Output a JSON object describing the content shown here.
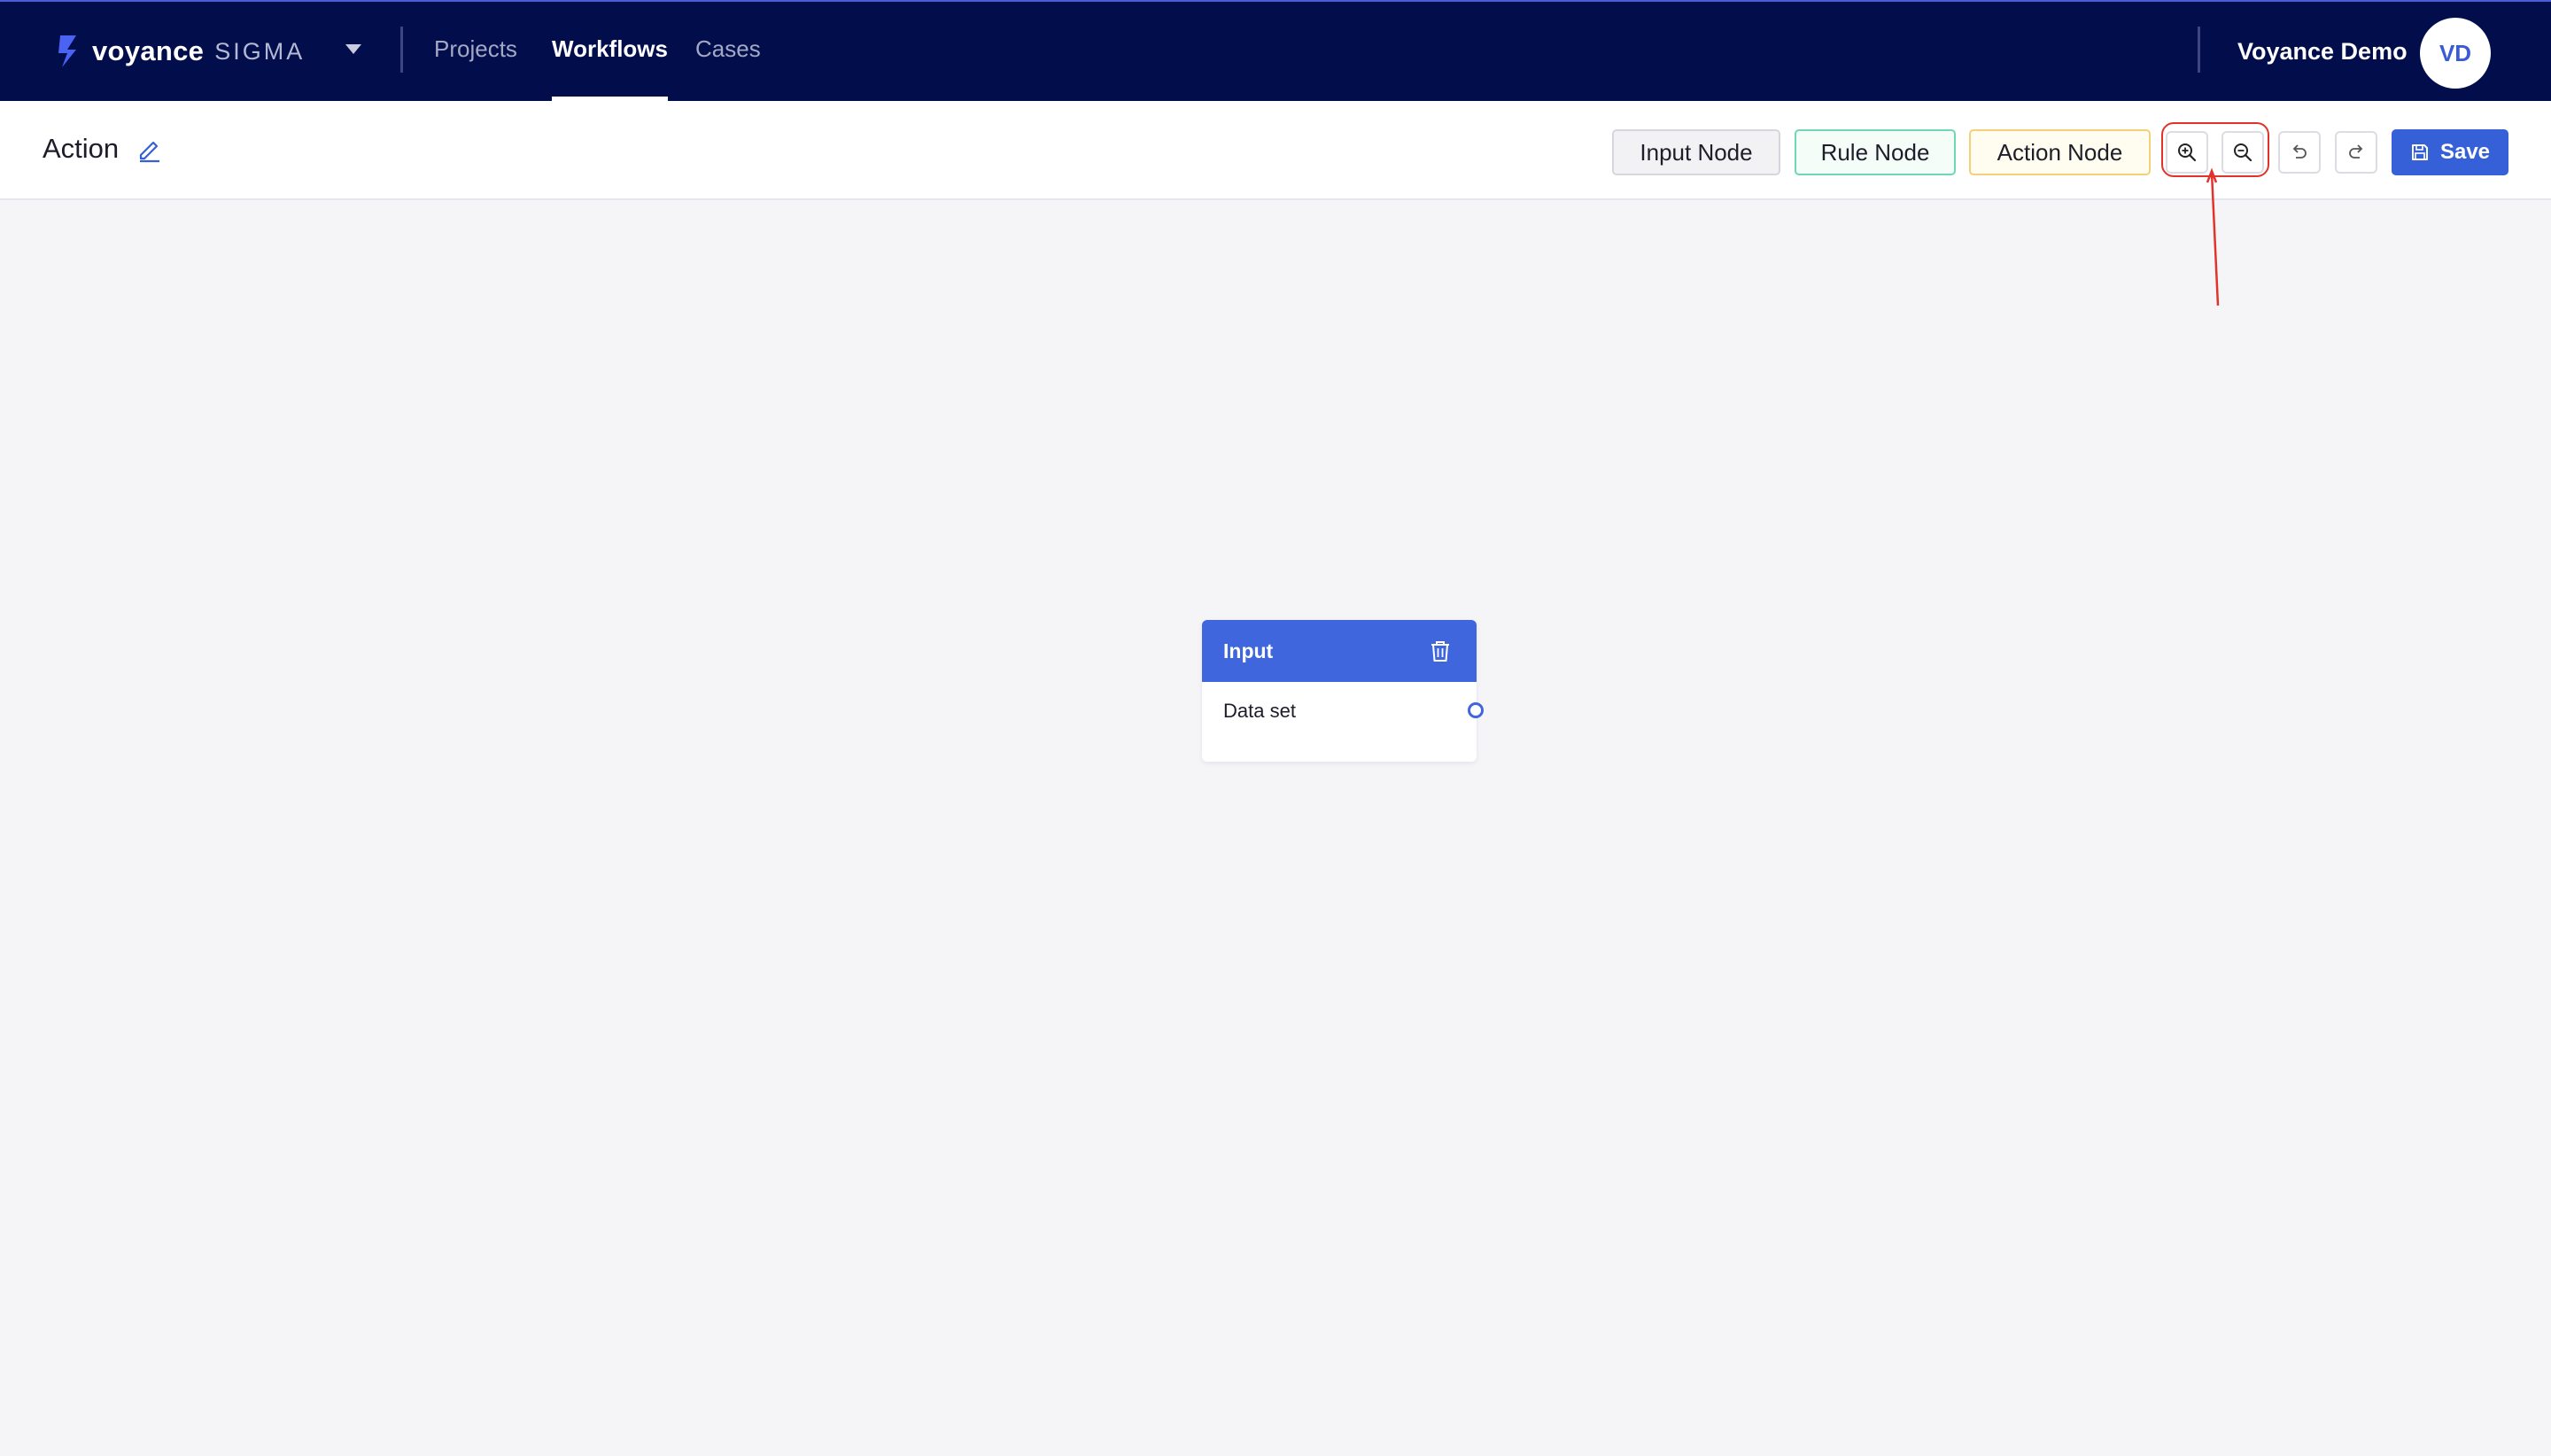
{
  "app": {
    "brand": "voyance",
    "product": "SIGMA"
  },
  "nav": {
    "links": [
      "Projects",
      "Workflows",
      "Cases"
    ],
    "active": "Workflows"
  },
  "user": {
    "name": "Voyance Demo",
    "initials": "VD"
  },
  "toolbar": {
    "title": "Action",
    "buttons": {
      "input_node": "Input Node",
      "rule_node": "Rule Node",
      "action_node": "Action Node",
      "save": "Save"
    },
    "icons": [
      "pencil-icon",
      "zoom-in-icon",
      "zoom-out-icon",
      "undo-icon",
      "redo-icon",
      "save-icon"
    ]
  },
  "canvas": {
    "nodes": [
      {
        "title": "Input",
        "field": "Data set",
        "icon": "trash-icon"
      }
    ]
  },
  "colors": {
    "nav_bg": "#020d4c",
    "accent": "#3560d8",
    "node_header": "#3f66dc",
    "highlight": "#e2332b"
  }
}
